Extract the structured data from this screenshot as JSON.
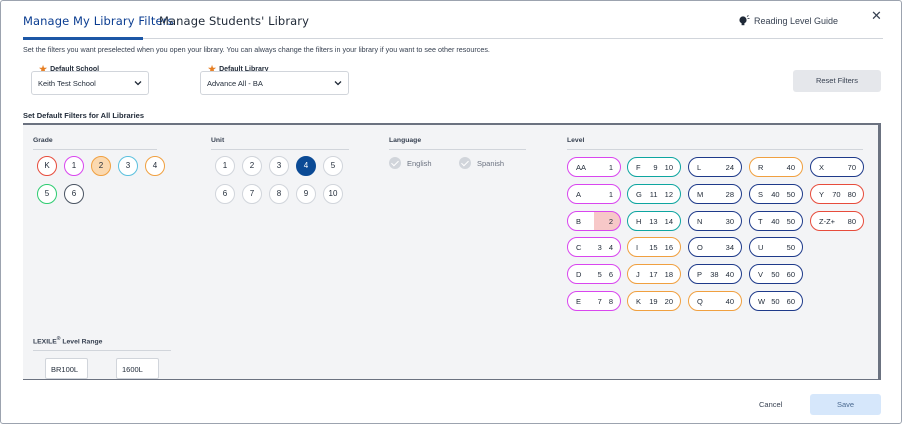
{
  "tabs": [
    {
      "label": "Manage My Library Filters",
      "active": true
    },
    {
      "label": "Manage Students' Library",
      "active": false
    }
  ],
  "header": {
    "reading_level_guide": "Reading Level Guide",
    "close_icon": "close-icon",
    "guide_icon": "lightbulb-icon"
  },
  "intro": "Set the filters you want preselected when you open your library. You can always change the filters in your library if you want to see other resources.",
  "default_school": {
    "label": "Default School",
    "value": "Keith Test School"
  },
  "default_library": {
    "label": "Default Library",
    "value": "Advance All - BA"
  },
  "reset_label": "Reset Filters",
  "section_title": "Set Default Filters for All Libraries",
  "grade": {
    "label": "Grade",
    "items": [
      {
        "label": "K",
        "color": "#e74c3c",
        "selected": false
      },
      {
        "label": "1",
        "color": "#d946ef",
        "selected": false
      },
      {
        "label": "2",
        "color": "#f0a040",
        "selected": true
      },
      {
        "label": "3",
        "color": "#5bc0de",
        "selected": false
      },
      {
        "label": "4",
        "color": "#f0a040",
        "selected": false
      },
      {
        "label": "5",
        "color": "#2ecc71",
        "selected": false
      },
      {
        "label": "6",
        "color": "#4b5563",
        "selected": false
      }
    ]
  },
  "unit": {
    "label": "Unit",
    "items": [
      "1",
      "2",
      "3",
      "4",
      "5",
      "6",
      "7",
      "8",
      "9",
      "10"
    ],
    "selected": "4"
  },
  "language": {
    "label": "Language",
    "items": [
      "English",
      "Spanish"
    ]
  },
  "level": {
    "label": "Level",
    "items": [
      {
        "name": "AA",
        "num": "1",
        "color": "#d946ef"
      },
      {
        "name": "A",
        "num": "1",
        "color": "#d946ef"
      },
      {
        "name": "B",
        "num": "2",
        "color": "#d946ef",
        "selected": true
      },
      {
        "name": "C",
        "num": "3 4",
        "color": "#d946ef"
      },
      {
        "name": "D",
        "num": "5 6",
        "color": "#d946ef"
      },
      {
        "name": "E",
        "num": "7 8",
        "color": "#d946ef"
      },
      {
        "name": "F",
        "num": "9 10",
        "color": "#0ea5a0"
      },
      {
        "name": "G",
        "num": "11 12",
        "color": "#0ea5a0"
      },
      {
        "name": "H",
        "num": "13 14",
        "color": "#0ea5a0"
      },
      {
        "name": "I",
        "num": "15 16",
        "color": "#f0a040"
      },
      {
        "name": "J",
        "num": "17 18",
        "color": "#f0a040"
      },
      {
        "name": "K",
        "num": "19 20",
        "color": "#f0a040"
      },
      {
        "name": "L",
        "num": "24",
        "color": "#1e3a8a"
      },
      {
        "name": "M",
        "num": "28",
        "color": "#1e3a8a"
      },
      {
        "name": "N",
        "num": "30",
        "color": "#1e3a8a"
      },
      {
        "name": "O",
        "num": "34",
        "color": "#1e3a8a"
      },
      {
        "name": "P",
        "num": "38 40",
        "color": "#1e3a8a"
      },
      {
        "name": "Q",
        "num": "40",
        "color": "#f0a040"
      },
      {
        "name": "R",
        "num": "40",
        "color": "#f0a040"
      },
      {
        "name": "S",
        "num": "40 50",
        "color": "#1e3a8a"
      },
      {
        "name": "T",
        "num": "40 50",
        "color": "#1e3a8a"
      },
      {
        "name": "U",
        "num": "50",
        "color": "#1e3a8a"
      },
      {
        "name": "V",
        "num": "50 60",
        "color": "#1e3a8a"
      },
      {
        "name": "W",
        "num": "50 60",
        "color": "#1e3a8a"
      },
      {
        "name": "X",
        "num": "70",
        "color": "#1e3a8a"
      },
      {
        "name": "Y",
        "num": "70 80",
        "color": "#e74c3c"
      },
      {
        "name": "Z-Z+",
        "num": "80",
        "color": "#e74c3c"
      }
    ]
  },
  "lexile": {
    "label_main": "LEXILE",
    "label_reg": "®",
    "label_rest": " Level Range",
    "min": "BR100L",
    "max": "1600L"
  },
  "footer": {
    "cancel": "Cancel",
    "save": "Save"
  },
  "colors": {
    "primary": "#1c57a6",
    "unit_selected": "#0b4a95",
    "grade_selected_fill": "#fbd9b0"
  }
}
